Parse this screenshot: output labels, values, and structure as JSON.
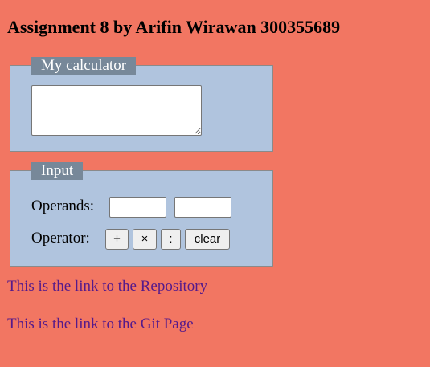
{
  "page": {
    "title": "Assignment 8 by Arifin Wirawan 300355689",
    "background": "#f27662",
    "panel_background": "#b0c4de",
    "legend_background": "#778899",
    "link_color": "#551a8b"
  },
  "calculator": {
    "legend": "My calculator",
    "result_value": ""
  },
  "input_panel": {
    "legend": "Input",
    "operands_label": "Operands:",
    "operand_a_value": "",
    "operand_b_value": "",
    "operator_label": "Operator:",
    "buttons": {
      "plus": "+",
      "times": "×",
      "divide": ":",
      "clear": "clear"
    }
  },
  "links": {
    "repository": "This is the link to the Repository",
    "git_page": "This is the link to the Git Page"
  }
}
